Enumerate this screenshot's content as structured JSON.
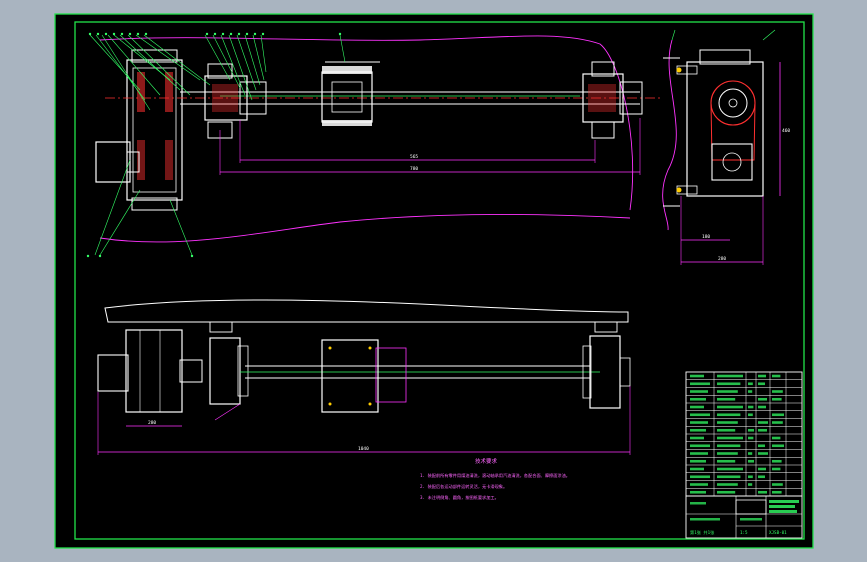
{
  "drawing": {
    "background": "#000000",
    "colors": {
      "frame": "#22e34a",
      "geometry": "#ffffff",
      "dimension": "#ff33ff",
      "annotation": "#33ff66",
      "hatch": "#ff3030",
      "centerline": "#ff3030",
      "notes_text": "#ff66ff"
    }
  },
  "notes": {
    "title": "技术要求",
    "lines": [
      "1. 装配前所有零件用煤油清洗，滚动轴承用汽油清洗，各配合面、摩擦面涂油。",
      "2. 装配后各运动部件运转灵活，无卡滞现象。",
      "3. 未注明倒角、圆角，按图纸要求加工。"
    ]
  },
  "dimensions": {
    "front_total": "780",
    "front_span": "565",
    "side_height": "460",
    "side_width": "180",
    "side_depth": "280",
    "plan_total": "1040",
    "plan_motor": "280"
  },
  "title_block": {
    "drawing_number": "XJSB-01",
    "scale": "1:5",
    "sheet": "第1张 共1张"
  }
}
